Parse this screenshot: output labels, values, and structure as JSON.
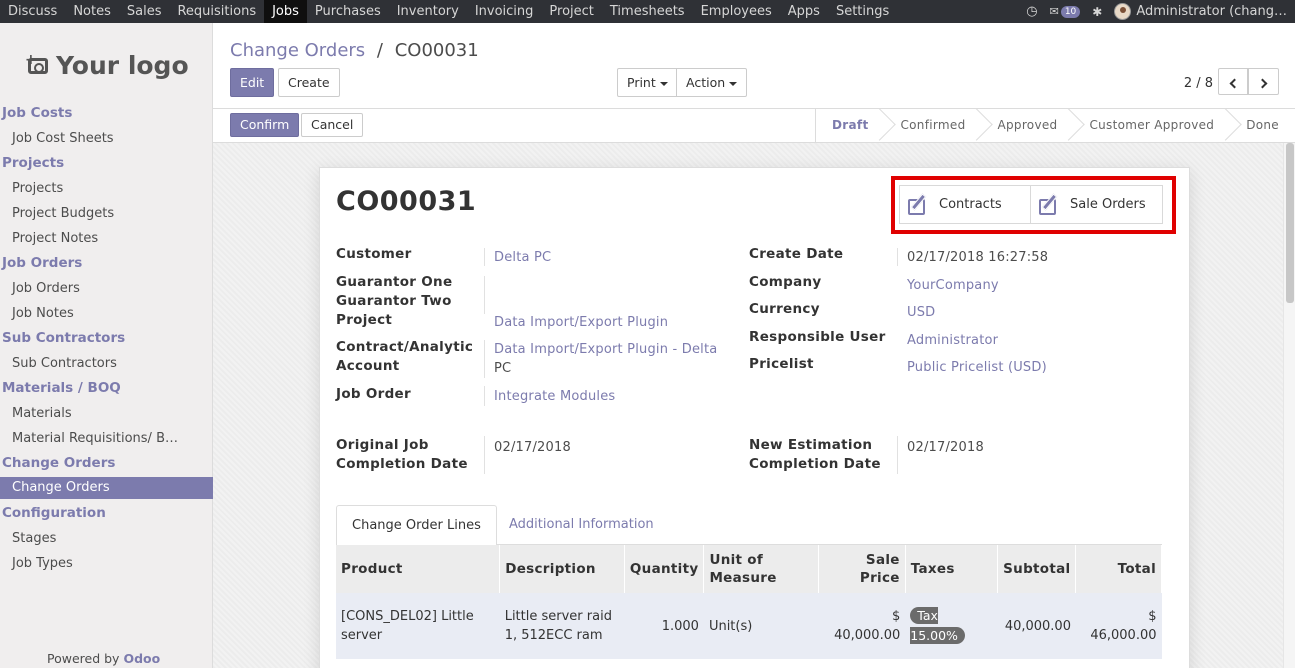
{
  "topbar": {
    "menu": [
      "Discuss",
      "Notes",
      "Sales",
      "Requisitions",
      "Jobs",
      "Purchases",
      "Inventory",
      "Invoicing",
      "Project",
      "Timesheets",
      "Employees",
      "Apps",
      "Settings"
    ],
    "active": "Jobs",
    "message_count": "10",
    "user": "Administrator (chang…"
  },
  "sidebar": {
    "logo_text": "Your logo",
    "sections": [
      {
        "title": "Job Costs",
        "items": [
          "Job Cost Sheets"
        ]
      },
      {
        "title": "Projects",
        "items": [
          "Projects",
          "Project Budgets",
          "Project Notes"
        ]
      },
      {
        "title": "Job Orders",
        "items": [
          "Job Orders",
          "Job Notes"
        ]
      },
      {
        "title": "Sub Contractors",
        "items": [
          "Sub Contractors"
        ]
      },
      {
        "title": "Materials / BOQ",
        "items": [
          "Materials",
          "Material Requisitions/ B…"
        ]
      },
      {
        "title": "Change Orders",
        "items": [
          "Change Orders"
        ]
      },
      {
        "title": "Configuration",
        "items": [
          "Stages",
          "Job Types"
        ]
      }
    ],
    "active_item": "Change Orders",
    "powered_by": "Powered by",
    "powered_brand": "Odoo"
  },
  "control_panel": {
    "breadcrumb_parent": "Change Orders",
    "breadcrumb_sep": "/",
    "breadcrumb_current": "CO00031",
    "edit_label": "Edit",
    "create_label": "Create",
    "print_label": "Print",
    "action_label": "Action",
    "pager": "2 / 8"
  },
  "statusbar": {
    "confirm_label": "Confirm",
    "cancel_label": "Cancel",
    "stages": [
      "Draft",
      "Confirmed",
      "Approved",
      "Customer Approved",
      "Done"
    ],
    "current_stage": "Draft"
  },
  "form": {
    "title": "CO00031",
    "smart_buttons": {
      "contracts": "Contracts",
      "sale_orders": "Sale Orders"
    },
    "left_fields": {
      "customer_label": "Customer",
      "customer_value": "Delta PC",
      "guarantor_one_label": "Guarantor One",
      "guarantor_two_label": "Guarantor Two",
      "project_label": "Project",
      "project_value": "Data Import/Export Plugin",
      "contract_label_1": "Contract/Analytic",
      "contract_label_2": "Account",
      "contract_value_1": "Data Import/Export Plugin - Delta",
      "contract_value_2": "PC",
      "job_order_label": "Job Order",
      "job_order_value": "Integrate Modules",
      "orig_date_label_1": "Original Job",
      "orig_date_label_2": "Completion Date",
      "orig_date_value": "02/17/2018"
    },
    "right_fields": {
      "create_date_label": "Create Date",
      "create_date_value": "02/17/2018 16:27:58",
      "company_label": "Company",
      "company_value": "YourCompany",
      "currency_label": "Currency",
      "currency_value": "USD",
      "responsible_label": "Responsible User",
      "responsible_value": "Administrator",
      "pricelist_label": "Pricelist",
      "pricelist_value": "Public Pricelist (USD)",
      "new_date_label_1": "New Estimation",
      "new_date_label_2": "Completion Date",
      "new_date_value": "02/17/2018"
    },
    "tabs": [
      "Change Order Lines",
      "Additional Information"
    ],
    "lines_table": {
      "headers": [
        "Product",
        "Description",
        "Quantity",
        "Unit of Measure",
        "Sale Price",
        "Taxes",
        "Subtotal",
        "Total"
      ],
      "rows": [
        {
          "product": "[CONS_DEL02] Little server",
          "description": "Little server raid 1, 512ECC ram",
          "quantity": "1.000",
          "uom": "Unit(s)",
          "sale_price": "$ 40,000.00",
          "taxes": "Tax 15.00%",
          "subtotal": "40,000.00",
          "total": "$ 46,000.00"
        }
      ]
    }
  },
  "colors": {
    "accent": "#7c7bad",
    "topbar": "#2f3136",
    "highlight": "#e00000"
  }
}
